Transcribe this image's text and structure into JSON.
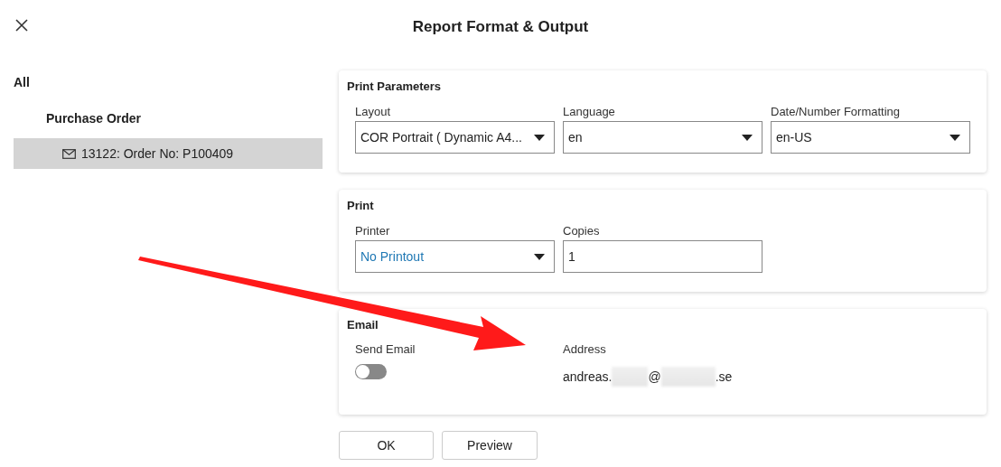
{
  "window": {
    "title": "Report Format & Output"
  },
  "sidebar": {
    "tree": [
      {
        "label": "All",
        "selected": false,
        "children": [
          {
            "label": "Purchase Order",
            "selected": false,
            "children": [
              {
                "label": "13122: Order No: P100409",
                "selected": true
              }
            ]
          }
        ]
      }
    ]
  },
  "sections": [
    {
      "title": "Print Parameters",
      "fields": [
        {
          "kind": "select",
          "label": "Layout",
          "value": "COR Portrait ( Dynamic A4...",
          "highlighted": false
        },
        {
          "kind": "select",
          "label": "Language",
          "value": "en",
          "highlighted": false
        },
        {
          "kind": "select",
          "label": "Date/Number Formatting",
          "value": "en-US",
          "highlighted": false
        }
      ]
    },
    {
      "title": "Print",
      "fields": [
        {
          "kind": "select",
          "label": "Printer",
          "value": "No Printout",
          "highlighted": true
        },
        {
          "kind": "input",
          "label": "Copies",
          "value": "1"
        }
      ]
    },
    {
      "title": "Email",
      "fields": [
        {
          "kind": "toggle",
          "label": "Send Email",
          "on": false
        },
        {
          "kind": "address",
          "label": "Address",
          "parts": [
            {
              "kind": "text",
              "text": "andreas."
            },
            {
              "kind": "redacted"
            },
            {
              "kind": "text",
              "text": "@"
            },
            {
              "kind": "redacted"
            },
            {
              "kind": "text",
              "text": ".se"
            }
          ]
        }
      ]
    }
  ],
  "buttons": [
    "OK",
    "Preview"
  ],
  "overlays": [
    {
      "kind": "arrow"
    }
  ]
}
